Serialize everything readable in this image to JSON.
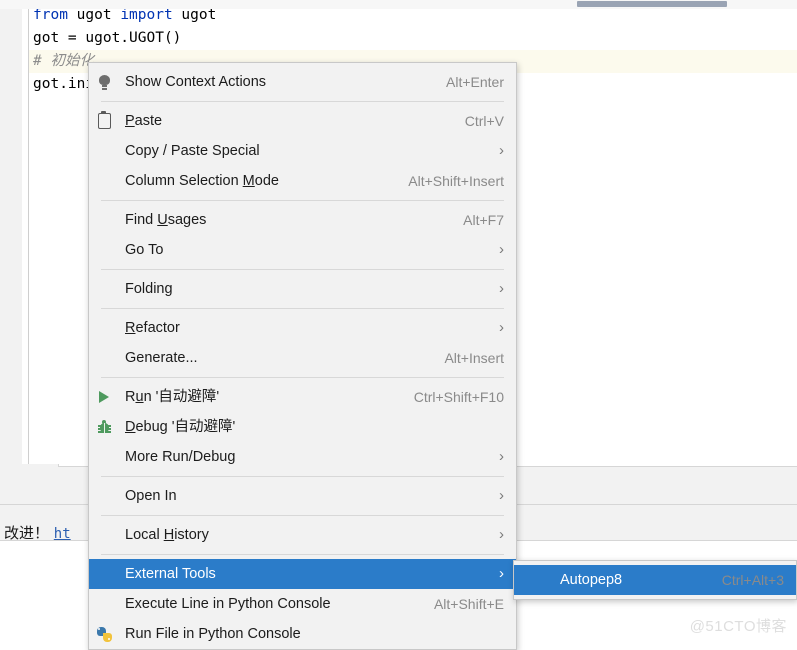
{
  "editor": {
    "lines": [
      {
        "type": "code",
        "current": false,
        "segments": [
          {
            "t": "from",
            "c": "kw"
          },
          {
            "t": " ugot ",
            "c": ""
          },
          {
            "t": "import",
            "c": "kw"
          },
          {
            "t": " ugot",
            "c": ""
          }
        ]
      },
      {
        "type": "code",
        "current": false,
        "segments": [
          {
            "t": "got = ugot.UGOT()",
            "c": ""
          }
        ]
      },
      {
        "type": "code",
        "current": true,
        "segments": [
          {
            "t": "# 初始化",
            "c": "cm"
          }
        ]
      },
      {
        "type": "code",
        "current": false,
        "segments": [
          {
            "t": "got.ini",
            "c": ""
          }
        ]
      }
    ],
    "line1_plain": "from ugot import ugot",
    "line2_plain": "got = ugot.UGOT()",
    "line3_plain": "# 初始化",
    "line4_plain": "got.ini"
  },
  "console": {
    "text_before": "改进！",
    "link_text": "ht"
  },
  "context_menu": {
    "items": [
      {
        "id": "show-context-actions",
        "label": "Show Context Actions",
        "accel": "Alt+Enter",
        "icon": "lightbulb-icon",
        "arrow": false,
        "selected": false,
        "mnemonic": ""
      },
      {
        "id": "separator-1",
        "separator": true
      },
      {
        "id": "paste",
        "label": "Paste",
        "accel": "Ctrl+V",
        "icon": "clipboard-icon",
        "arrow": false,
        "selected": false,
        "mnemonic": "P"
      },
      {
        "id": "copy-paste-special",
        "label": "Copy / Paste Special",
        "accel": "",
        "icon": "",
        "arrow": true,
        "selected": false,
        "mnemonic": ""
      },
      {
        "id": "column-selection-mode",
        "label": "Column Selection Mode",
        "accel": "Alt+Shift+Insert",
        "icon": "",
        "arrow": false,
        "selected": false,
        "mnemonic": "M"
      },
      {
        "id": "separator-2",
        "separator": true
      },
      {
        "id": "find-usages",
        "label": "Find Usages",
        "accel": "Alt+F7",
        "icon": "",
        "arrow": false,
        "selected": false,
        "mnemonic": "U"
      },
      {
        "id": "go-to",
        "label": "Go To",
        "accel": "",
        "icon": "",
        "arrow": true,
        "selected": false,
        "mnemonic": ""
      },
      {
        "id": "separator-3",
        "separator": true
      },
      {
        "id": "folding",
        "label": "Folding",
        "accel": "",
        "icon": "",
        "arrow": true,
        "selected": false,
        "mnemonic": ""
      },
      {
        "id": "separator-4",
        "separator": true
      },
      {
        "id": "refactor",
        "label": "Refactor",
        "accel": "",
        "icon": "",
        "arrow": true,
        "selected": false,
        "mnemonic": "R"
      },
      {
        "id": "generate",
        "label": "Generate...",
        "accel": "Alt+Insert",
        "icon": "",
        "arrow": false,
        "selected": false,
        "mnemonic": ""
      },
      {
        "id": "separator-5",
        "separator": true
      },
      {
        "id": "run-config",
        "label": "Run '自动避障'",
        "accel": "Ctrl+Shift+F10",
        "icon": "run-icon",
        "arrow": false,
        "selected": false,
        "mnemonic": "u"
      },
      {
        "id": "debug-config",
        "label": "Debug '自动避障'",
        "accel": "",
        "icon": "debug-icon",
        "arrow": false,
        "selected": false,
        "mnemonic": "D"
      },
      {
        "id": "more-run-debug",
        "label": "More Run/Debug",
        "accel": "",
        "icon": "",
        "arrow": true,
        "selected": false,
        "mnemonic": ""
      },
      {
        "id": "separator-6",
        "separator": true
      },
      {
        "id": "open-in",
        "label": "Open In",
        "accel": "",
        "icon": "",
        "arrow": true,
        "selected": false,
        "mnemonic": ""
      },
      {
        "id": "separator-7",
        "separator": true
      },
      {
        "id": "local-history",
        "label": "Local History",
        "accel": "",
        "icon": "",
        "arrow": true,
        "selected": false,
        "mnemonic": "H"
      },
      {
        "id": "separator-8",
        "separator": true
      },
      {
        "id": "external-tools",
        "label": "External Tools",
        "accel": "",
        "icon": "",
        "arrow": true,
        "selected": true,
        "mnemonic": ""
      },
      {
        "id": "execute-line-in-python-console",
        "label": "Execute Line in Python Console",
        "accel": "Alt+Shift+E",
        "icon": "",
        "arrow": false,
        "selected": false,
        "mnemonic": ""
      },
      {
        "id": "run-file-in-python-console",
        "label": "Run File in Python Console",
        "accel": "",
        "icon": "python-icon",
        "arrow": false,
        "selected": false,
        "mnemonic": ""
      }
    ]
  },
  "submenu": {
    "items": [
      {
        "id": "autopep8",
        "label": "Autopep8",
        "accel": "Ctrl+Alt+3",
        "selected": true
      }
    ]
  },
  "watermark": {
    "text": "@51CTO博客"
  },
  "colors": {
    "selection": "#2b7cc9",
    "menu_bg": "#f2f2f2",
    "accel_text": "#8a8a8a",
    "keyword": "#0033b3",
    "comment": "#8c8c8c",
    "current_line": "#fcfaed",
    "scroll_thumb": "#9aa4b4",
    "link": "#2a5db0"
  }
}
